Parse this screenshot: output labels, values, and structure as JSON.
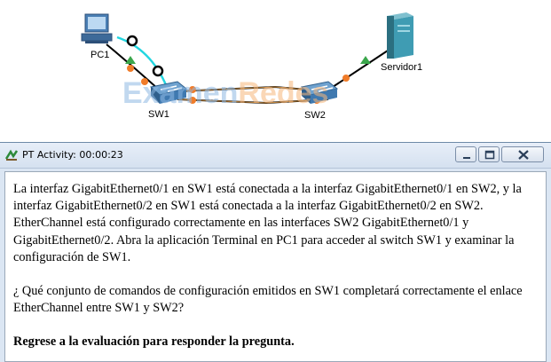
{
  "topology": {
    "devices": {
      "pc1": "PC1",
      "sw1": "SW1",
      "sw2": "SW2",
      "server": "Servidor1"
    },
    "watermark": {
      "part1": "Examen",
      "part2": "Redes"
    },
    "colors": {
      "cable_copper": "#000000",
      "cable_console": "#22d6e0",
      "link_up": "#3aa64b",
      "link_negotiating": "#f07c2a",
      "ether_channel": "#c98a3c"
    }
  },
  "window": {
    "title": "PT Activity: 00:00:23",
    "controls": [
      "minimize-icon",
      "maximize-icon",
      "close-icon"
    ],
    "paragraphs": [
      "La interfaz GigabitEthernet0/1 en SW1 está conectada a la interfaz GigabitEthernet0/1 en SW2, y la interfaz GigabitEthernet0/2 en SW1 está conectada a la interfaz GigabitEthernet0/2 en SW2. EtherChannel está configurado correctamente en las interfaces SW2 GigabitEthernet0/1 y GigabitEthernet0/2. Abra la aplicación Terminal en PC1 para acceder al switch SW1 y examinar la configuración de SW1.",
      "¿ Qué conjunto de comandos de configuración emitidos en SW1 completará correctamente el enlace EtherChannel entre SW1 y SW2?",
      "Regrese a la evaluación para responder la pregunta."
    ]
  }
}
